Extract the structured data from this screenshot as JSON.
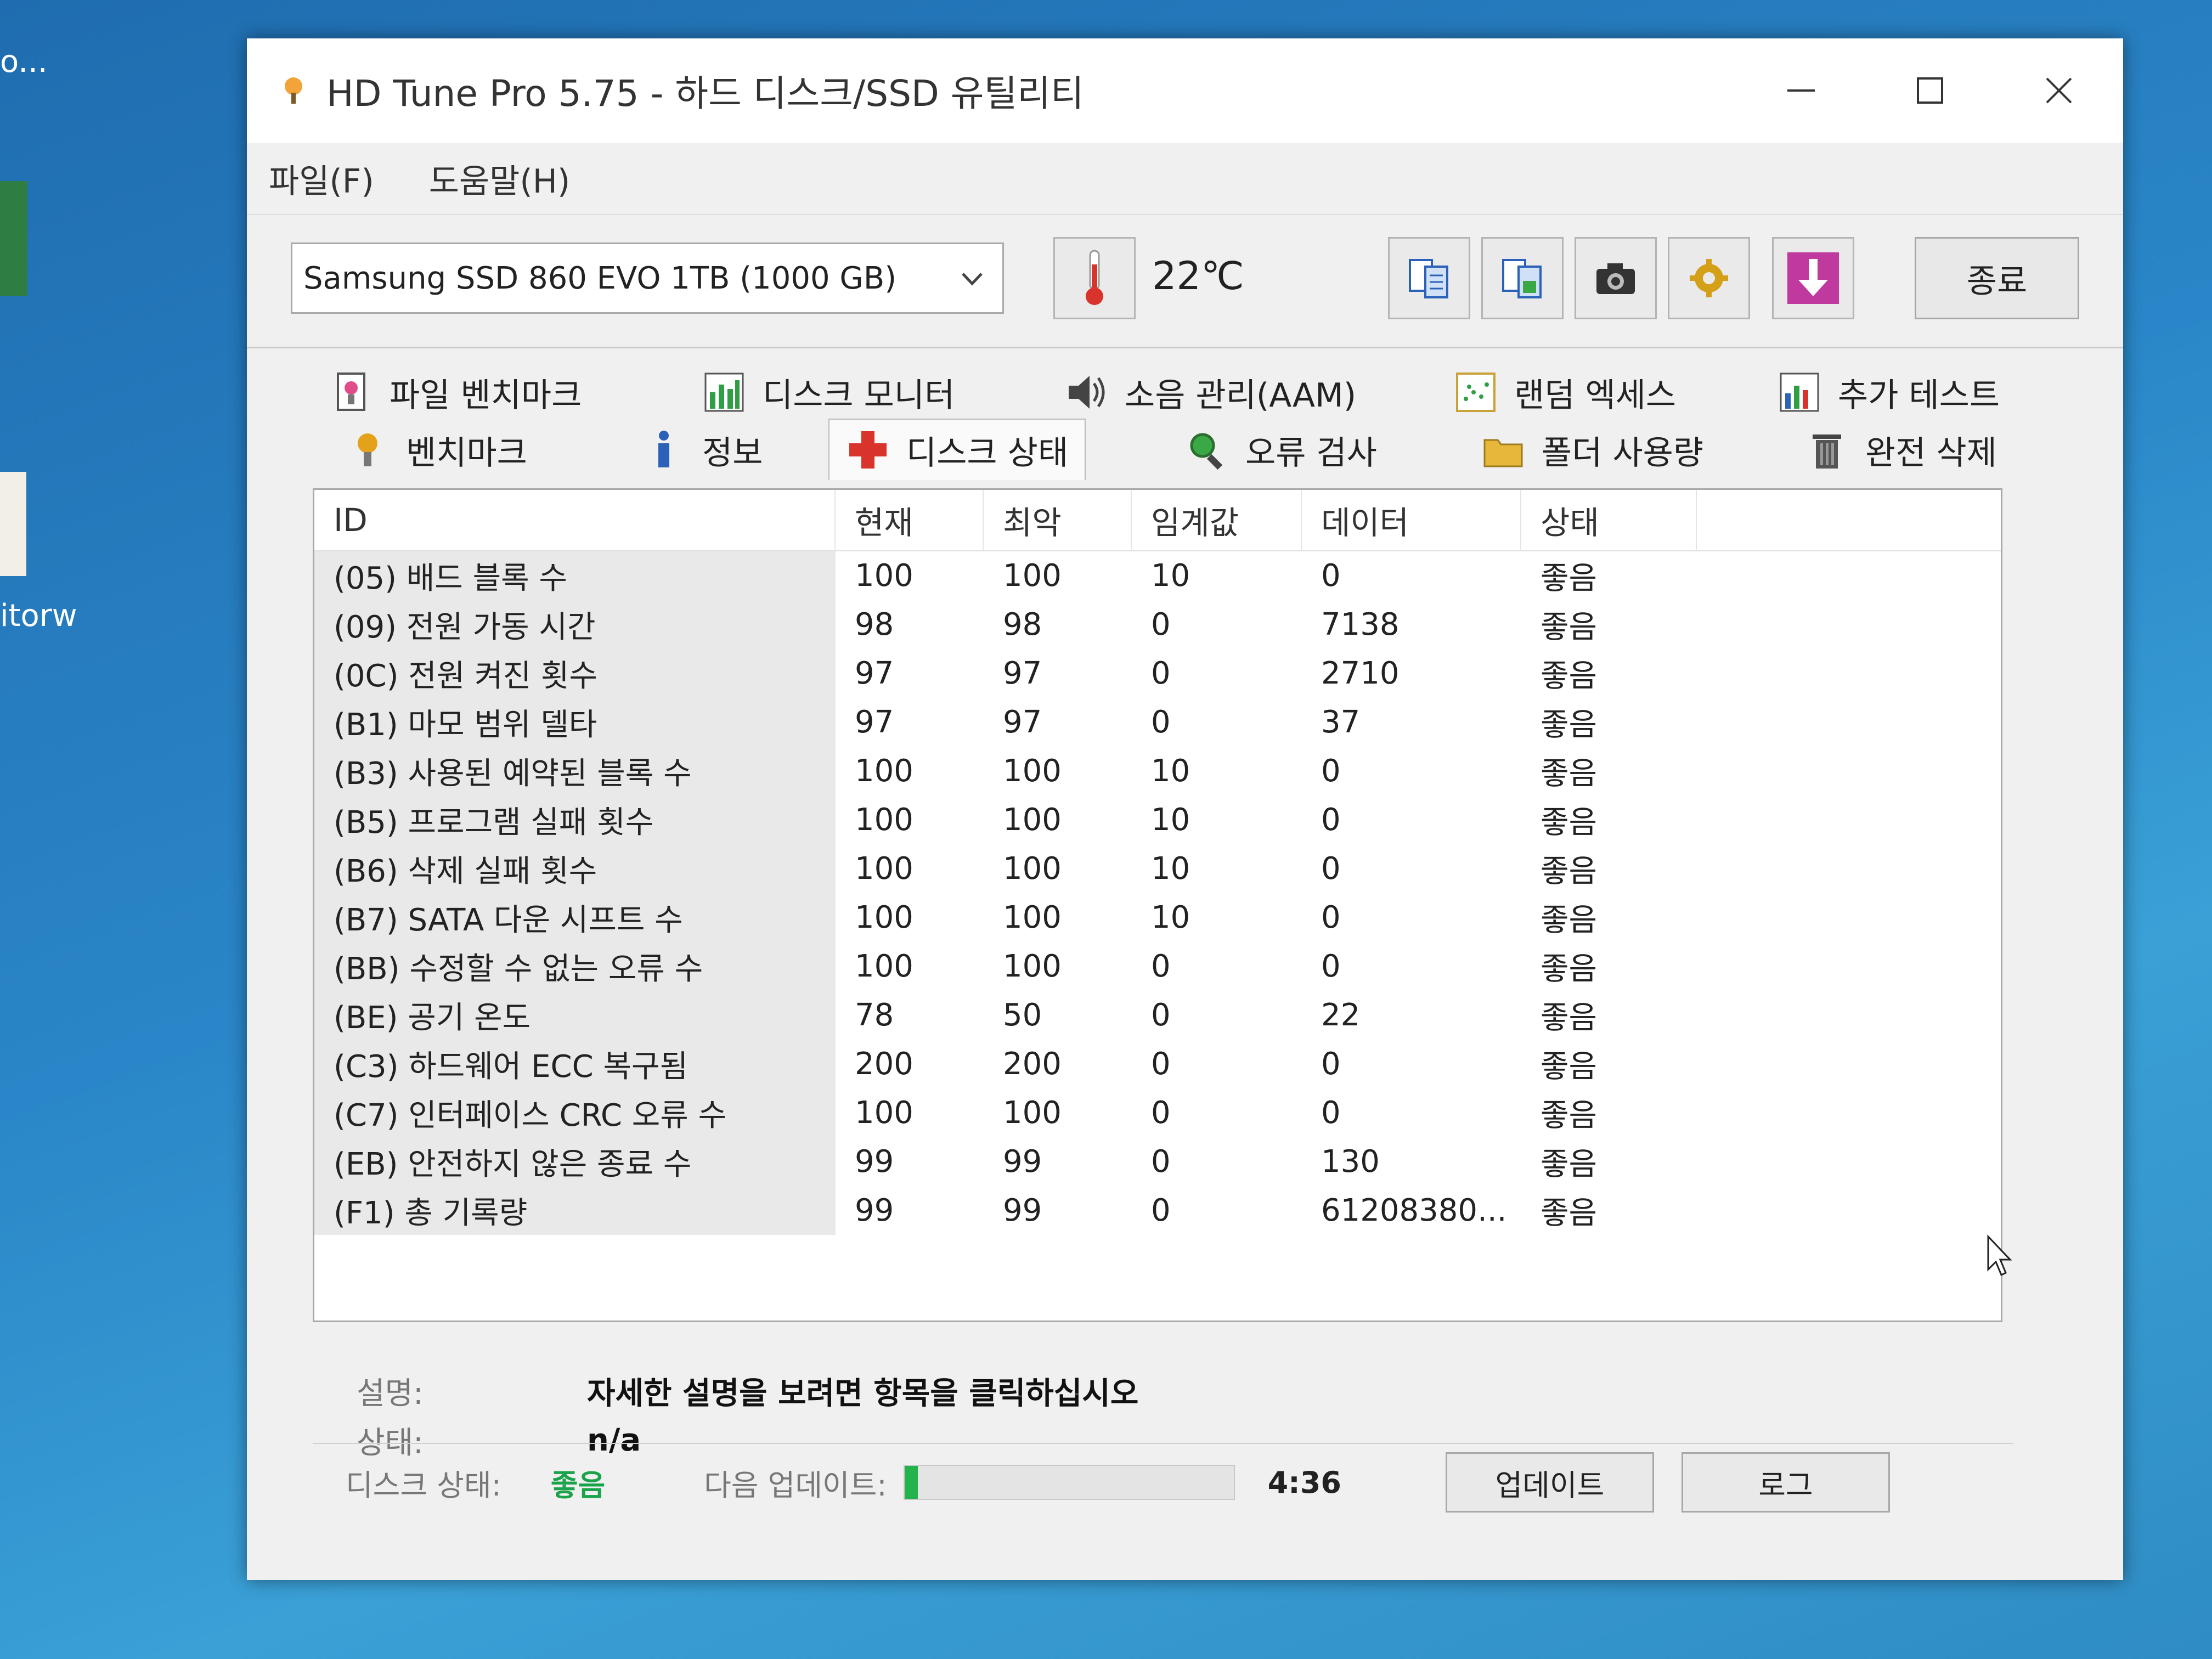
{
  "desktop": {
    "top_label": "o...",
    "side_label": "itorw"
  },
  "window": {
    "title": "HD Tune Pro 5.75 - 하드 디스크/SSD 유틸리티"
  },
  "menu": {
    "file": "파일(F)",
    "help": "도움말(H)"
  },
  "toolbar": {
    "drive": "Samsung SSD 860 EVO 1TB (1000 GB)",
    "temperature": "22℃",
    "exit_label": "종료",
    "icons": [
      "copy-text-icon",
      "copy-screenshot-icon",
      "camera-icon",
      "options-icon",
      "save-icon"
    ]
  },
  "tabs": {
    "row1": [
      {
        "label": "파일 벤치마크",
        "icon": "file-benchmark-icon"
      },
      {
        "label": "디스크 모니터",
        "icon": "disk-monitor-icon"
      },
      {
        "label": "소음 관리(AAM)",
        "icon": "speaker-icon"
      },
      {
        "label": "랜덤 엑세스",
        "icon": "random-access-icon"
      },
      {
        "label": "추가 테스트",
        "icon": "extra-tests-icon"
      }
    ],
    "row2": [
      {
        "label": "벤치마크",
        "icon": "benchmark-icon"
      },
      {
        "label": "정보",
        "icon": "info-icon"
      },
      {
        "label": "디스크 상태",
        "icon": "health-cross-icon"
      },
      {
        "label": "오류 검사",
        "icon": "magnifier-icon"
      },
      {
        "label": "폴더 사용량",
        "icon": "folder-icon"
      },
      {
        "label": "완전 삭제",
        "icon": "trash-icon"
      }
    ],
    "active": "디스크 상태"
  },
  "table": {
    "headers": {
      "id": "ID",
      "current": "현재",
      "worst": "최악",
      "threshold": "임계값",
      "data": "데이터",
      "status": "상태"
    },
    "rows": [
      {
        "id": "(05) 배드 블록 수",
        "current": "100",
        "worst": "100",
        "threshold": "10",
        "data": "0",
        "status": "좋음"
      },
      {
        "id": "(09) 전원 가동 시간",
        "current": "98",
        "worst": "98",
        "threshold": "0",
        "data": "7138",
        "status": "좋음"
      },
      {
        "id": "(0C) 전원 켜진 횟수",
        "current": "97",
        "worst": "97",
        "threshold": "0",
        "data": "2710",
        "status": "좋음"
      },
      {
        "id": "(B1) 마모 범위 델타",
        "current": "97",
        "worst": "97",
        "threshold": "0",
        "data": "37",
        "status": "좋음"
      },
      {
        "id": "(B3) 사용된 예약된 블록 수",
        "current": "100",
        "worst": "100",
        "threshold": "10",
        "data": "0",
        "status": "좋음"
      },
      {
        "id": "(B5) 프로그램 실패 횟수",
        "current": "100",
        "worst": "100",
        "threshold": "10",
        "data": "0",
        "status": "좋음"
      },
      {
        "id": "(B6) 삭제 실패 횟수",
        "current": "100",
        "worst": "100",
        "threshold": "10",
        "data": "0",
        "status": "좋음"
      },
      {
        "id": "(B7) SATA 다운 시프트 수",
        "current": "100",
        "worst": "100",
        "threshold": "10",
        "data": "0",
        "status": "좋음"
      },
      {
        "id": "(BB) 수정할 수 없는 오류 수",
        "current": "100",
        "worst": "100",
        "threshold": "0",
        "data": "0",
        "status": "좋음"
      },
      {
        "id": "(BE) 공기 온도",
        "current": "78",
        "worst": "50",
        "threshold": "0",
        "data": "22",
        "status": "좋음"
      },
      {
        "id": "(C3) 하드웨어 ECC 복구됨",
        "current": "200",
        "worst": "200",
        "threshold": "0",
        "data": "0",
        "status": "좋음"
      },
      {
        "id": "(C7) 인터페이스 CRC 오류 수",
        "current": "100",
        "worst": "100",
        "threshold": "0",
        "data": "0",
        "status": "좋음"
      },
      {
        "id": "(EB) 안전하지 않은 종료 수",
        "current": "99",
        "worst": "99",
        "threshold": "0",
        "data": "130",
        "status": "좋음"
      },
      {
        "id": "(F1) 총 기록량",
        "current": "99",
        "worst": "99",
        "threshold": "0",
        "data": "61208380...",
        "status": "좋음"
      }
    ]
  },
  "details": {
    "desc_label": "설명:",
    "desc_value": "자세한 설명을 보려면 항목을 클릭하십시오",
    "status_label": "상태:",
    "status_value": "n/a"
  },
  "footer": {
    "disk_status_label": "디스크 상태:",
    "disk_status_value": "좋음",
    "next_update_label": "다음 업데이트:",
    "progress_fraction": 0.04,
    "time": "4:36",
    "update_button": "업데이트",
    "log_button": "로그"
  },
  "colors": {
    "good": "#1aa34a",
    "progress": "#23b24b",
    "save_button": "#c0399e"
  }
}
